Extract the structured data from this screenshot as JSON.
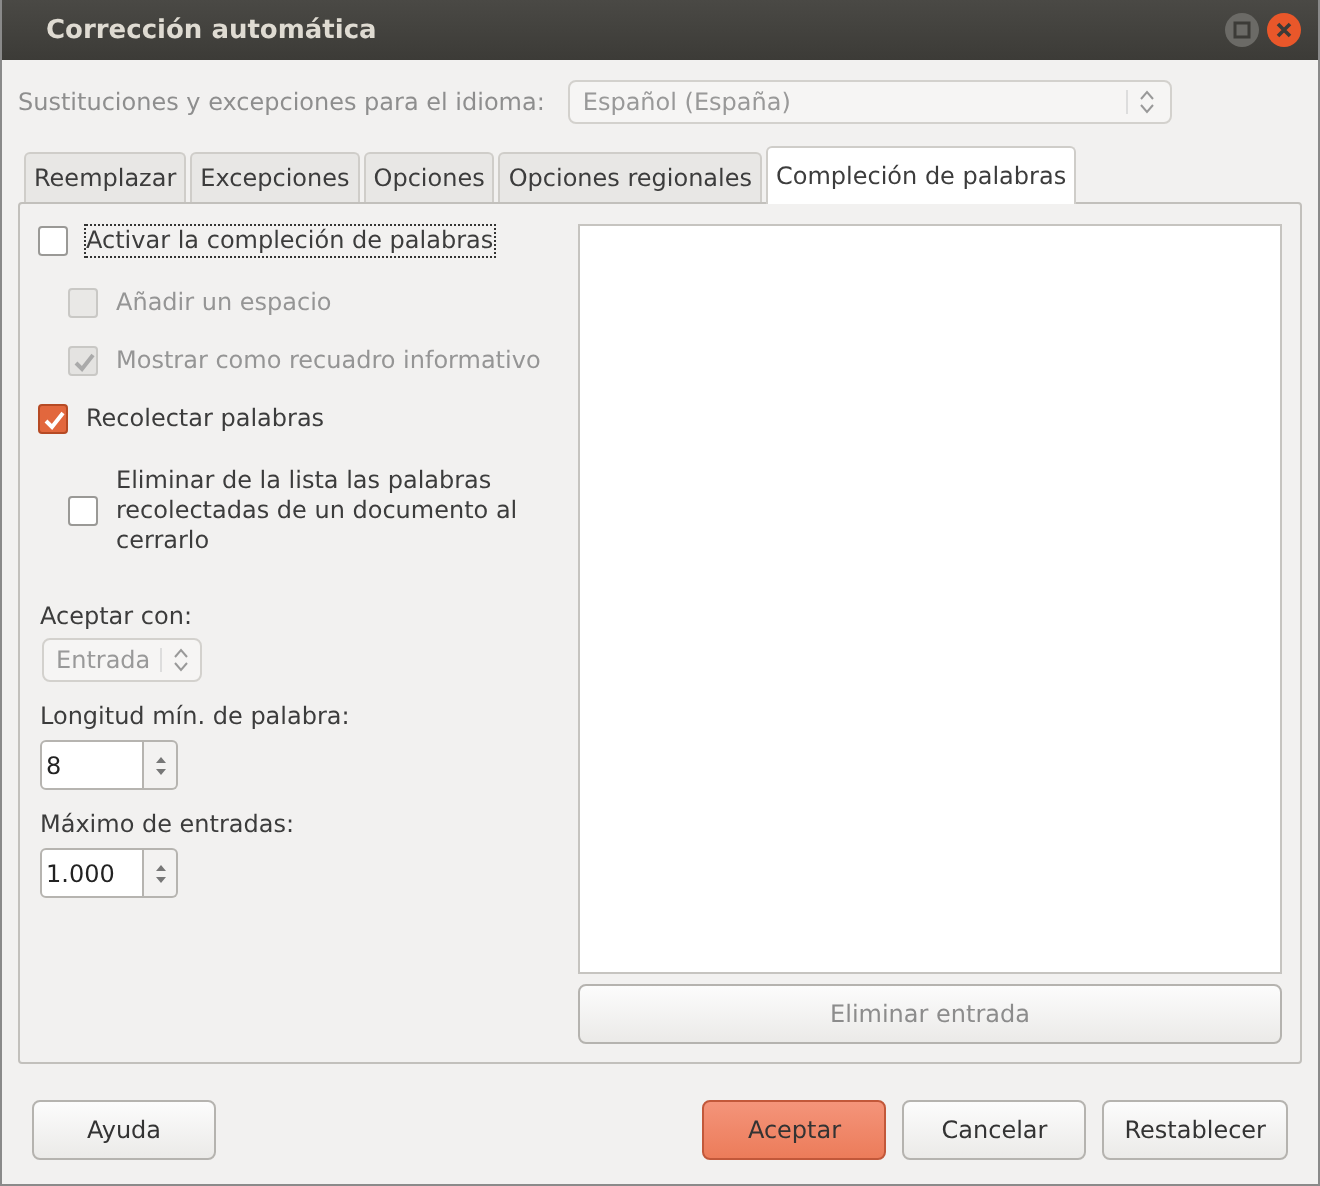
{
  "window": {
    "title": "Corrección automática"
  },
  "language": {
    "label": "Sustituciones y excepciones para el idioma:",
    "value": "Español (España)",
    "disabled": true
  },
  "tabs": [
    {
      "label": "Reemplazar",
      "selected": false
    },
    {
      "label": "Excepciones",
      "selected": false
    },
    {
      "label": "Opciones",
      "selected": false
    },
    {
      "label": "Opciones regionales",
      "selected": false
    },
    {
      "label": "Compleción de palabras",
      "selected": true
    }
  ],
  "options": [
    {
      "label": "Activar la compleción de palabras",
      "checked": false,
      "focused": true,
      "children": [
        {
          "label": "Añadir un espacio",
          "checked": false,
          "disabled": true
        },
        {
          "label": "Mostrar como recuadro informativo",
          "checked": true,
          "disabled": true
        }
      ]
    },
    {
      "label": "Recolectar palabras",
      "checked": true,
      "focused": false,
      "children": [
        {
          "label": "Eliminar de la lista las palabras recolectadas de un documento al cerrarlo",
          "checked": false,
          "disabled": false
        }
      ]
    }
  ],
  "fields": [
    {
      "kind": "dropdown",
      "label": "Aceptar con:",
      "value": "Entrada",
      "disabled": true
    },
    {
      "kind": "spin",
      "label": "Longitud mín. de palabra:",
      "value": "8"
    },
    {
      "kind": "spin",
      "label": "Máximo de entradas:",
      "value": "1.000"
    }
  ],
  "delete_entry": {
    "label": "Eliminar entrada",
    "disabled": true
  },
  "buttons": [
    {
      "label": "Ayuda",
      "kind": "help"
    },
    {
      "label": "Aceptar",
      "kind": "primary"
    },
    {
      "label": "Cancelar",
      "kind": "normal"
    },
    {
      "label": "Restablecer",
      "kind": "normal"
    }
  ]
}
